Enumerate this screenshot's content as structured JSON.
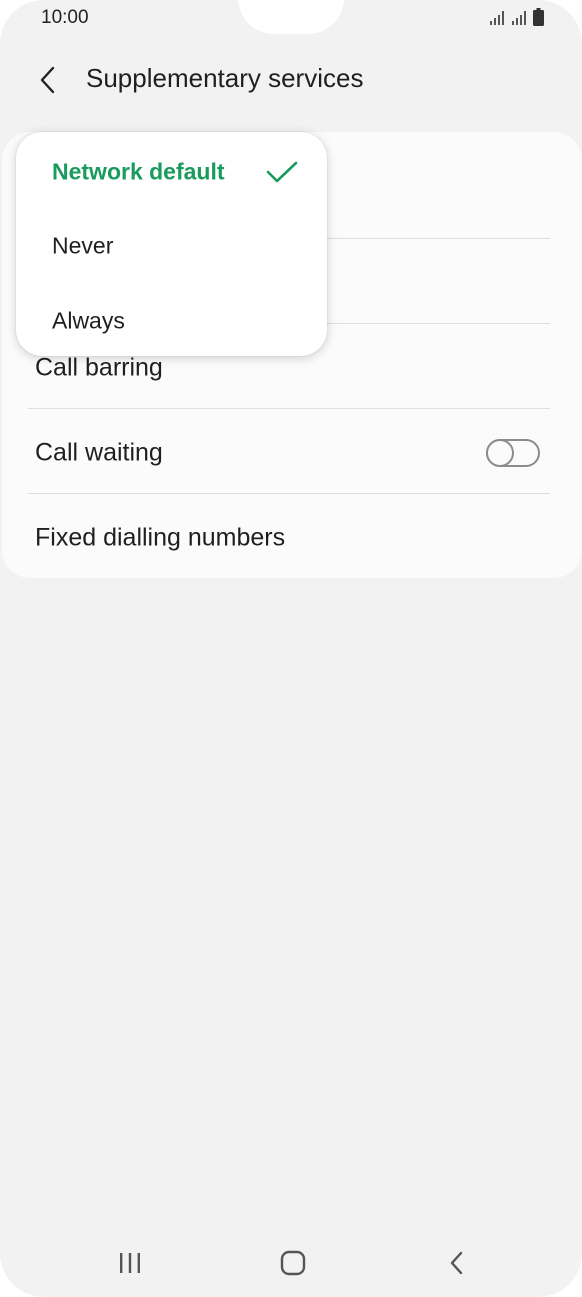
{
  "status_bar": {
    "time": "10:00"
  },
  "app_bar": {
    "title": "Supplementary services"
  },
  "settings": {
    "items": [
      {
        "label": "Call barring"
      },
      {
        "label": "Call waiting",
        "toggle_on": false
      },
      {
        "label": "Fixed dialling numbers"
      }
    ]
  },
  "popup": {
    "options": [
      {
        "label": "Network default",
        "selected": true
      },
      {
        "label": "Never",
        "selected": false
      },
      {
        "label": "Always",
        "selected": false
      }
    ]
  },
  "colors": {
    "accent": "#1a9b5e",
    "background": "#f2f2f2",
    "card": "#fbfbfb"
  },
  "icons": {
    "back": "chevron-left-icon",
    "check": "check-icon",
    "recents": "recents-icon",
    "home": "home-icon",
    "nav_back": "nav-back-icon"
  }
}
